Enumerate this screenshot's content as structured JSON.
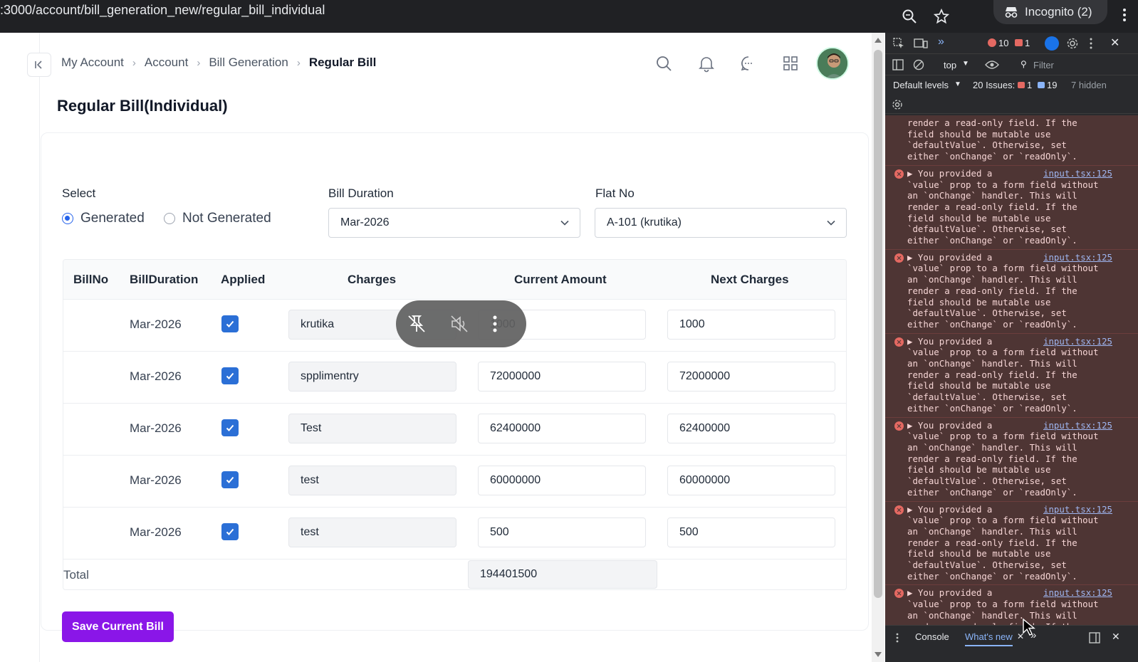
{
  "browser": {
    "url": ":3000/account/bill_generation_new/regular_bill_individual",
    "incognito_label": "Incognito (2)"
  },
  "breadcrumb": [
    {
      "label": "My Account"
    },
    {
      "label": "Account"
    },
    {
      "label": "Bill Generation"
    },
    {
      "label": "Regular Bill"
    }
  ],
  "page": {
    "title": "Regular Bill(Individual)"
  },
  "filters": {
    "select_label": "Select",
    "radio_generated": "Generated",
    "radio_not_generated": "Not Generated",
    "bill_duration_label": "Bill Duration",
    "bill_duration_value": "Mar-2026",
    "flat_no_label": "Flat No",
    "flat_no_value": "A-101 (krutika)"
  },
  "table": {
    "headers": {
      "bill_no": "BillNo",
      "bill_duration": "BillDuration",
      "applied": "Applied",
      "charges": "Charges",
      "current_amount": "Current Amount",
      "next_charges": "Next Charges"
    },
    "rows": [
      {
        "duration": "Mar-2026",
        "charge": "krutika",
        "current": "1000",
        "next": "1000"
      },
      {
        "duration": "Mar-2026",
        "charge": "spplimentry",
        "current": "72000000",
        "next": "72000000"
      },
      {
        "duration": "Mar-2026",
        "charge": "Test",
        "current": "62400000",
        "next": "62400000"
      },
      {
        "duration": "Mar-2026",
        "charge": "test",
        "current": "60000000",
        "next": "60000000"
      },
      {
        "duration": "Mar-2026",
        "charge": "test",
        "current": "500",
        "next": "500"
      }
    ],
    "total_label": "Total",
    "total_value": "194401500"
  },
  "actions": {
    "save_label": "Save Current Bill"
  },
  "devtools": {
    "errors_count": "10",
    "warnings_count": "1",
    "context": "top",
    "filter_placeholder": "Filter",
    "levels": "Default levels",
    "issues_label": "20 Issues:",
    "issues_errors": "1",
    "issues_info": "19",
    "hidden": "7 hidden",
    "message_partial": "render a read-only field. If the\nfield should be mutable use\n`defaultValue`. Otherwise, set\neither `onChange` or `readOnly`.",
    "message_full": "▶ You provided a\n`value` prop to a form field without\nan `onChange` handler. This will\nrender a read-only field. If the\nfield should be mutable use\n`defaultValue`. Otherwise, set\neither `onChange` or `readOnly`.",
    "message_last": "▶ You provided a\n`value` prop to a form field without\nan `onChange` handler. This will\nrender a read-only field. If the",
    "message_source": "input.tsx:125",
    "tab_console": "Console",
    "tab_whats_new": "What's new"
  },
  "colors": {
    "accent": "#8a16e8",
    "checkbox": "#2b6fd6",
    "radio": "#2563eb",
    "devtools_error_bg": "#4e3534"
  }
}
